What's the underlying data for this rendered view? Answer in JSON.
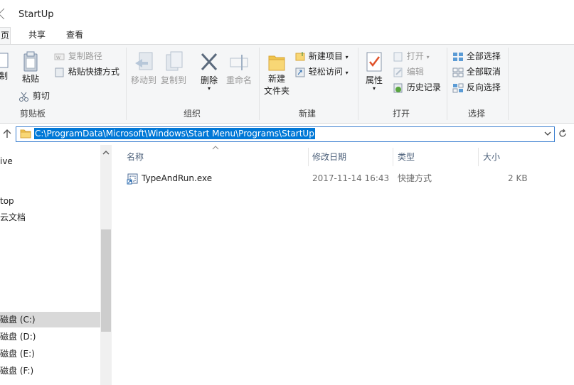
{
  "window": {
    "title": "StartUp"
  },
  "tabs": [
    {
      "label": "页",
      "active": true
    },
    {
      "label": "共享"
    },
    {
      "label": "查看"
    }
  ],
  "ribbon": {
    "clipboard": {
      "copy_label": "制",
      "paste_label": "粘贴",
      "copy_path_label": "复制路径",
      "paste_shortcut_label": "粘贴快捷方式",
      "cut_label": "剪切",
      "group_label": "剪贴板"
    },
    "organize": {
      "move_to_label": "移动到",
      "copy_to_label": "复制到",
      "delete_label": "删除",
      "rename_label": "重命名",
      "group_label": "组织"
    },
    "new": {
      "new_folder_line1": "新建",
      "new_folder_line2": "文件夹",
      "new_item_label": "新建项目",
      "easy_access_label": "轻松访问",
      "group_label": "新建"
    },
    "open": {
      "properties_label": "属性",
      "open_label": "打开",
      "edit_label": "编辑",
      "history_label": "历史记录",
      "group_label": "打开"
    },
    "select": {
      "select_all_label": "全部选择",
      "select_none_label": "全部取消",
      "invert_label": "反向选择",
      "group_label": "选择"
    }
  },
  "address": {
    "path": "C:\\ProgramData\\Microsoft\\Windows\\Start Menu\\Programs\\StartUp"
  },
  "nav": {
    "items": [
      {
        "label": "ive"
      },
      {
        "label": "top"
      },
      {
        "label": "云文档"
      },
      {
        "label": "磁盘 (C:)",
        "selected": true
      },
      {
        "label": "磁盘 (D:)"
      },
      {
        "label": "磁盘 (E:)"
      },
      {
        "label": "磁盘 (F:)"
      }
    ]
  },
  "list": {
    "columns": {
      "name": "名称",
      "modified": "修改日期",
      "type": "类型",
      "size": "大小"
    },
    "rows": [
      {
        "name": "TypeAndRun.exe",
        "modified": "2017-11-14 16:43",
        "type": "快捷方式",
        "size": "2 KB"
      }
    ]
  },
  "colors": {
    "accent": "#0078d7",
    "selection": "#cce8ff",
    "nav_selected": "#d9d9d9"
  }
}
